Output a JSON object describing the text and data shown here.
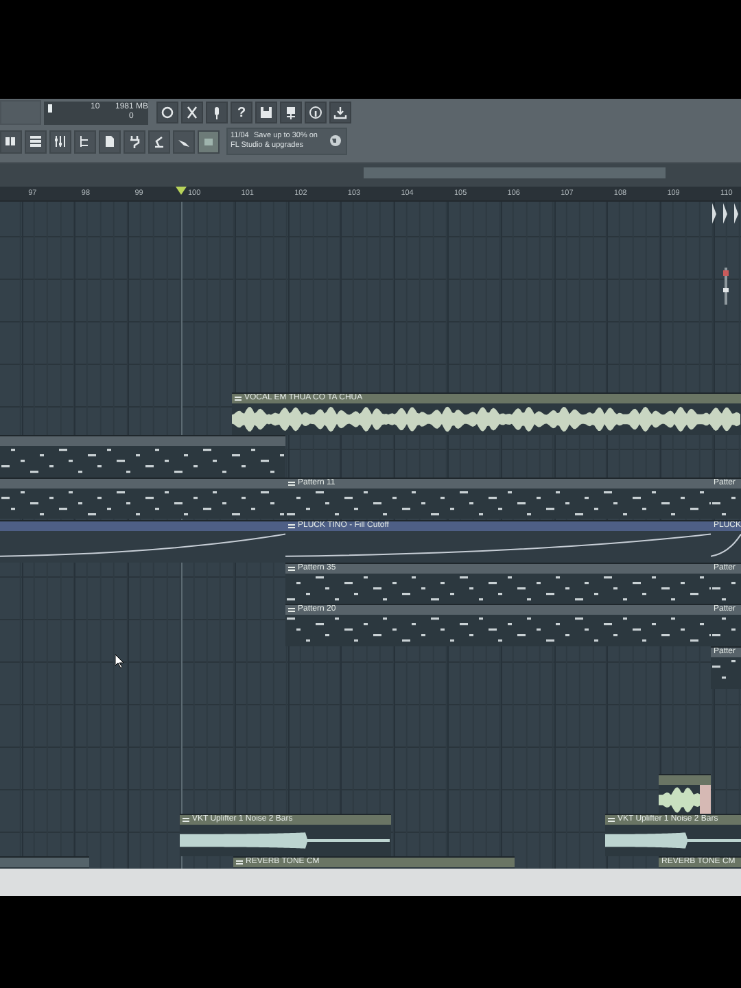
{
  "toolbar": {
    "cpu": "10",
    "memory": "1981 MB",
    "polyphony": "0",
    "help": "?",
    "news": {
      "date": "11/04",
      "line_1": "Save up to 30% on",
      "line_2": "FL Studio & upgrades"
    }
  },
  "ruler": {
    "bars": [
      "97",
      "98",
      "99",
      "100",
      "101",
      "102",
      "103",
      "104",
      "105",
      "106",
      "107",
      "108",
      "109",
      "110"
    ]
  },
  "clips": [
    {
      "kind": "audio",
      "label": "VOCAL EM THUA CO TA CHUA"
    },
    {
      "kind": "pattern"
    },
    {
      "kind": "pattern"
    },
    {
      "kind": "pattern",
      "label": "Pattern 11"
    },
    {
      "kind": "pattern",
      "label": "Patter"
    },
    {
      "kind": "automation"
    },
    {
      "kind": "automation",
      "label": "PLUCK TINO - Fill Cutoff"
    },
    {
      "kind": "automation",
      "label": "PLUCK"
    },
    {
      "kind": "pattern",
      "label": "Pattern 35"
    },
    {
      "kind": "pattern",
      "label": "Patter"
    },
    {
      "kind": "pattern",
      "label": "Pattern 20"
    },
    {
      "kind": "pattern",
      "label": "Patter"
    },
    {
      "kind": "pattern",
      "label": "Patter"
    },
    {
      "kind": "audio"
    },
    {
      "kind": "audio",
      "label": "VKT Uplifter 1 Noise 2 Bars"
    },
    {
      "kind": "audio",
      "label": "VKT Uplifter 1 Noise 2 Bars"
    },
    {
      "kind": "audio",
      "label": "REVERB TONE CM"
    },
    {
      "kind": "audio",
      "label": "REVERB TONE CM"
    },
    {
      "kind": "audio"
    }
  ]
}
